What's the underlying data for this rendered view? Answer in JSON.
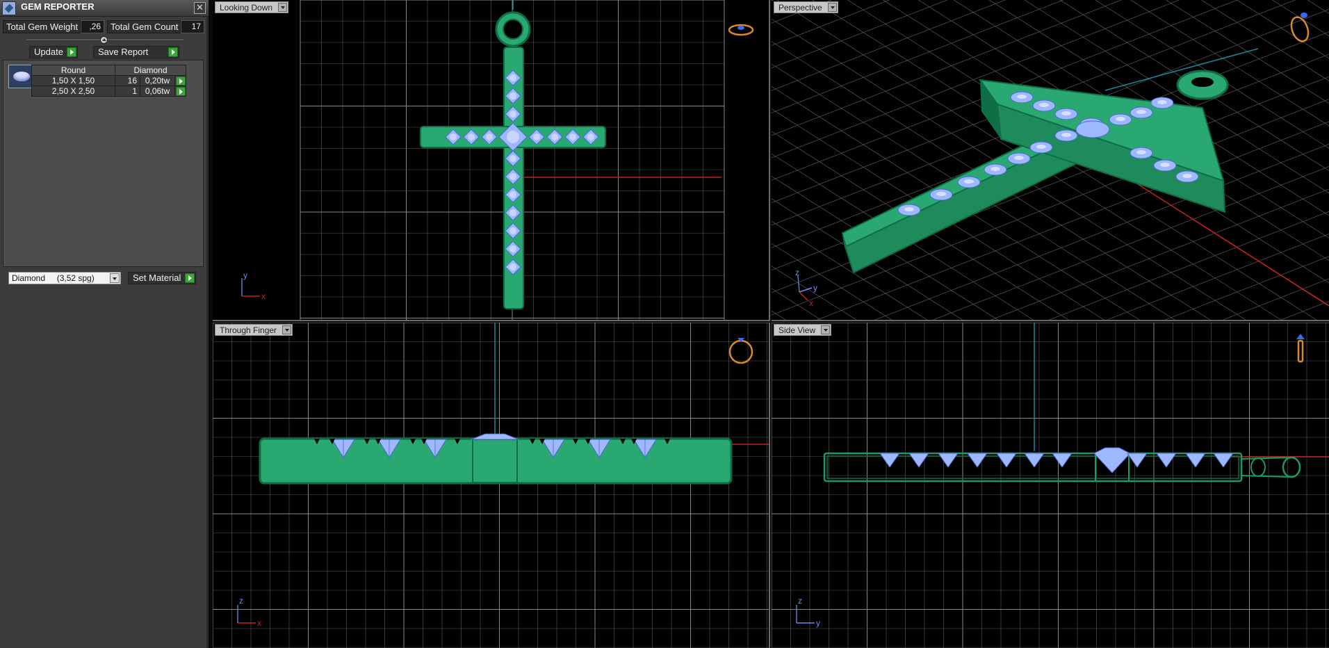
{
  "panel": {
    "title": "GEM REPORTER",
    "close_glyph": "✕",
    "total_weight_label": "Total Gem Weight",
    "total_weight_value": ",26",
    "total_count_label": "Total Gem Count",
    "total_count_value": "17",
    "update_label": "Update",
    "save_report_label": "Save Report",
    "table": {
      "headers": [
        "Round",
        "Diamond"
      ],
      "rows": [
        {
          "size": "1,50 X 1,50",
          "count": "16",
          "weight": "0,20tw"
        },
        {
          "size": "2,50 X 2,50",
          "count": "1",
          "weight": "0,06tw"
        }
      ]
    },
    "material_value": "Diamond     (3,52 spg)",
    "set_material_label": "Set Material"
  },
  "viewports": {
    "top": {
      "label": "Looking Down",
      "axis_v": "y",
      "axis_h": "x"
    },
    "perspective": {
      "label": "Perspective",
      "axis_v": "z",
      "axis_h": "y",
      "axis_d": "x"
    },
    "front": {
      "label": "Through Finger",
      "axis_v": "z",
      "axis_h": "x"
    },
    "side": {
      "label": "Side View",
      "axis_v": "z",
      "axis_h": "y"
    }
  },
  "colors": {
    "metal": "#2aa872",
    "metal_dark": "#0e6e46",
    "gem": "#9db8ff",
    "grid": "#5a5a5a",
    "axis_red": "#c42020",
    "axis_cyan": "#1a8aa0",
    "accent_green": "#3aa53a"
  }
}
